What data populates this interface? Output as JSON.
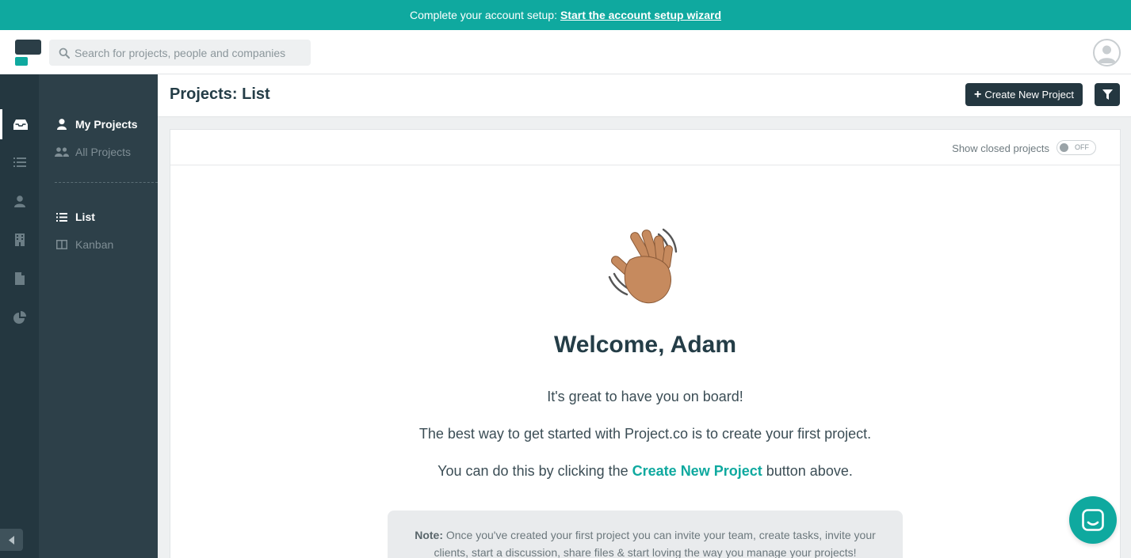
{
  "banner": {
    "text": "Complete your account setup:",
    "link": "Start the account setup wizard"
  },
  "search": {
    "placeholder": "Search for projects, people and companies"
  },
  "sidebar": {
    "rail": [
      "inbox-icon",
      "list-icon",
      "user-icon",
      "building-icon",
      "file-icon",
      "pie-chart-icon"
    ],
    "projects": [
      {
        "label": "My Projects",
        "active": true
      },
      {
        "label": "All Projects",
        "active": false
      }
    ],
    "views": [
      {
        "label": "List",
        "active": true
      },
      {
        "label": "Kanban",
        "active": false
      }
    ]
  },
  "header": {
    "title": "Projects: List",
    "create_button": "Create New Project"
  },
  "panel": {
    "closed_label": "Show closed projects",
    "toggle": "OFF"
  },
  "welcome": {
    "heading": "Welcome, Adam",
    "line1": "It's great to have you on board!",
    "line2": "The best way to get started with Project.co is to create your first project.",
    "line3_before": "You can do this by clicking the",
    "line3_link": "Create New Project",
    "line3_after": "button above."
  },
  "note": {
    "label": "Note:",
    "text": "Once you've created your first project you can invite your team, create tasks, invite your clients, start a discussion, share files & start loving the way you manage your projects!"
  },
  "colors": {
    "accent": "#0fa99f",
    "dark": "#243740",
    "sidebar": "#2d4049"
  }
}
